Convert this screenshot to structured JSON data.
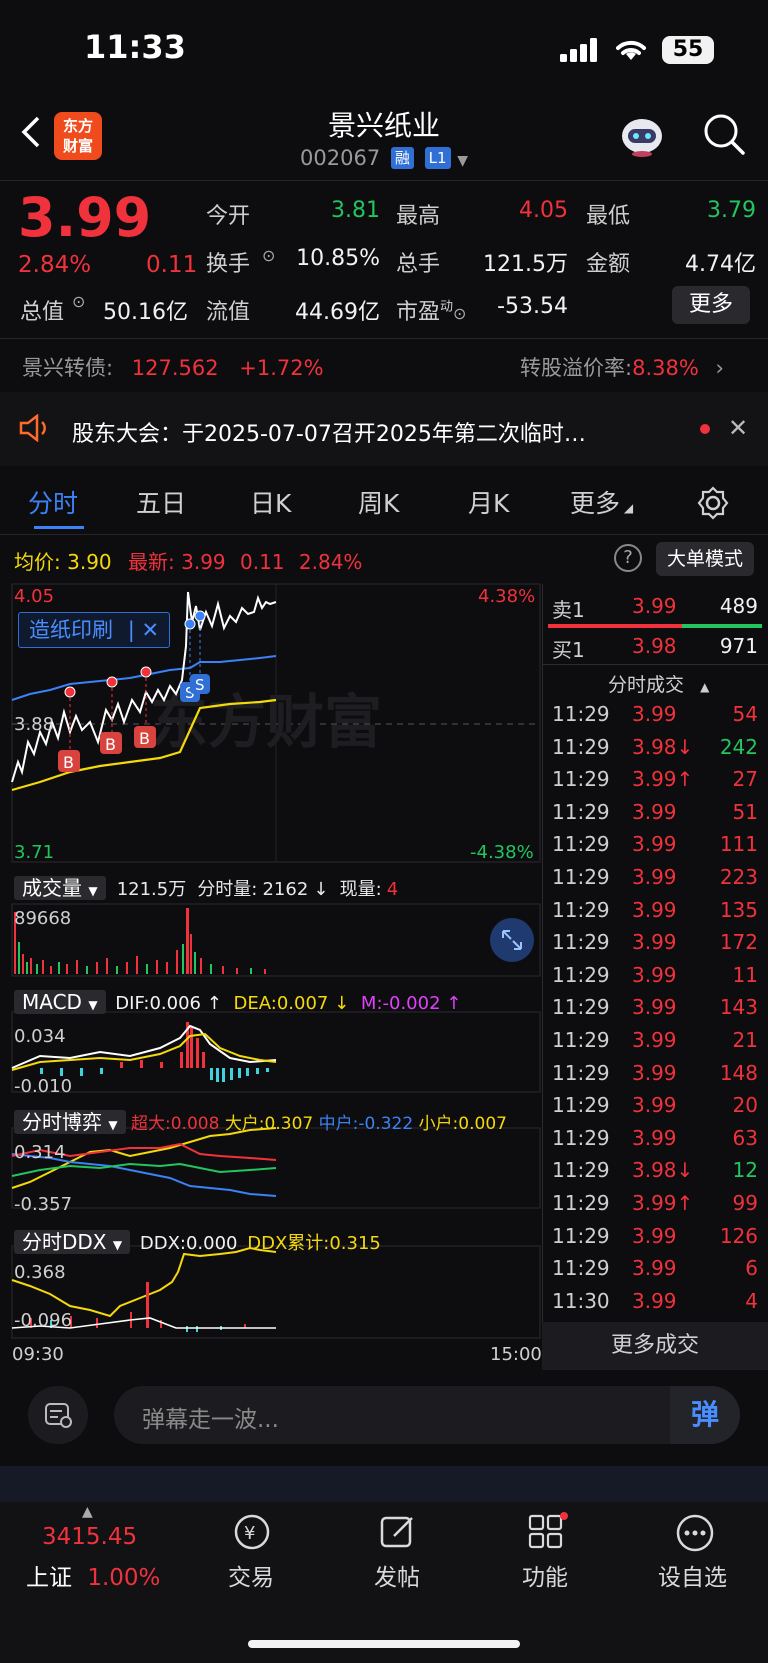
{
  "status": {
    "time": "11:33",
    "battery": "55"
  },
  "header": {
    "logo_line1": "东方",
    "logo_line2": "财富",
    "name": "景兴纸业",
    "code": "002067",
    "tag1": "融",
    "tag2": "L1"
  },
  "quote": {
    "price": "3.99",
    "pct": "2.84%",
    "chg": "0.11",
    "open_label": "今开",
    "open": "3.81",
    "high_label": "最高",
    "high": "4.05",
    "low_label": "最低",
    "low": "3.79",
    "turnover_label": "换手",
    "turnover": "10.85%",
    "volume_label": "总手",
    "volume": "121.5万",
    "amount_label": "金额",
    "amount": "4.74亿",
    "mcap_label": "总值",
    "mcap": "50.16亿",
    "float_label": "流值",
    "float": "44.69亿",
    "pe_label": "市盈",
    "pe_sup": "动",
    "pe": "-53.54",
    "more": "更多"
  },
  "bond": {
    "name": "景兴转债:",
    "price": "127.562",
    "pct": "+1.72%",
    "premium_label": "转股溢价率:",
    "premium": "8.38%"
  },
  "notice": {
    "text": "股东大会：于2025-07-07召开2025年第二次临时…"
  },
  "tabs": [
    "分时",
    "五日",
    "日K",
    "周K",
    "月K",
    "更多"
  ],
  "chart_header": {
    "avg_label": "均价:",
    "avg": "3.90",
    "last_label": "最新:",
    "last": "3.99",
    "chg": "0.11",
    "pct": "2.84%",
    "mode": "大单模式"
  },
  "price_chart": {
    "top": "4.05",
    "mid": "3.88",
    "bottom": "3.71",
    "top_pct": "4.38%",
    "bottom_pct": "-4.38%",
    "sector": "造纸印刷",
    "watermark": "东方财富"
  },
  "volume_panel": {
    "label": "成交量",
    "total": "121.5万",
    "min_label": "分时量:",
    "min_vol": "2162",
    "now_label": "现量:",
    "now_vol": "4",
    "max": "89668"
  },
  "macd_panel": {
    "label": "MACD",
    "dif": "DIF:0.006 ↑",
    "dea": "DEA:0.007 ↓",
    "m": "M:-0.002 ↑",
    "top": "0.034",
    "bottom": "-0.010"
  },
  "game_panel": {
    "label": "分时博弈",
    "super": "超大:0.008",
    "big": "大户:0.307",
    "mid": "中户:-0.322",
    "small": "小户:0.007",
    "top": "0.314",
    "bottom": "-0.357"
  },
  "ddx_panel": {
    "label": "分时DDX",
    "ddx": "DDX:0.000",
    "ddx_sum": "DDX累计:0.315",
    "top": "0.368",
    "bottom": "-0.096"
  },
  "time_axis": {
    "start": "09:30",
    "end": "15:00"
  },
  "orderbook": {
    "sell_label": "卖1",
    "sell_price": "3.99",
    "sell_vol": "489",
    "buy_label": "买1",
    "buy_price": "3.98",
    "buy_vol": "971"
  },
  "ticks_title": "分时成交",
  "ticks": [
    {
      "t": "11:29",
      "p": "3.99",
      "v": "54",
      "d": "r"
    },
    {
      "t": "11:29",
      "p": "3.98↓",
      "v": "242",
      "d": "g"
    },
    {
      "t": "11:29",
      "p": "3.99↑",
      "v": "27",
      "d": "r"
    },
    {
      "t": "11:29",
      "p": "3.99",
      "v": "51",
      "d": "r"
    },
    {
      "t": "11:29",
      "p": "3.99",
      "v": "111",
      "d": "r"
    },
    {
      "t": "11:29",
      "p": "3.99",
      "v": "223",
      "d": "r"
    },
    {
      "t": "11:29",
      "p": "3.99",
      "v": "135",
      "d": "r"
    },
    {
      "t": "11:29",
      "p": "3.99",
      "v": "172",
      "d": "r"
    },
    {
      "t": "11:29",
      "p": "3.99",
      "v": "11",
      "d": "r"
    },
    {
      "t": "11:29",
      "p": "3.99",
      "v": "143",
      "d": "r"
    },
    {
      "t": "11:29",
      "p": "3.99",
      "v": "21",
      "d": "r"
    },
    {
      "t": "11:29",
      "p": "3.99",
      "v": "148",
      "d": "r"
    },
    {
      "t": "11:29",
      "p": "3.99",
      "v": "20",
      "d": "r"
    },
    {
      "t": "11:29",
      "p": "3.99",
      "v": "63",
      "d": "r"
    },
    {
      "t": "11:29",
      "p": "3.98↓",
      "v": "12",
      "d": "g"
    },
    {
      "t": "11:29",
      "p": "3.99↑",
      "v": "99",
      "d": "r"
    },
    {
      "t": "11:29",
      "p": "3.99",
      "v": "126",
      "d": "r"
    },
    {
      "t": "11:29",
      "p": "3.99",
      "v": "6",
      "d": "r"
    },
    {
      "t": "11:30",
      "p": "3.99",
      "v": "4",
      "d": "r"
    }
  ],
  "more_ticks": "更多成交",
  "danmu": {
    "placeholder": "弹幕走一波...",
    "btn": "弹"
  },
  "tabbar": {
    "index_value": "3415.45",
    "index_name": "上证",
    "index_pct": "1.00%",
    "trade": "交易",
    "post": "发帖",
    "func": "功能",
    "watch": "设自选"
  },
  "colors": {
    "up": "#f0323c",
    "down": "#22c55e",
    "accent": "#3b82f6",
    "avg": "#f5d90a"
  }
}
